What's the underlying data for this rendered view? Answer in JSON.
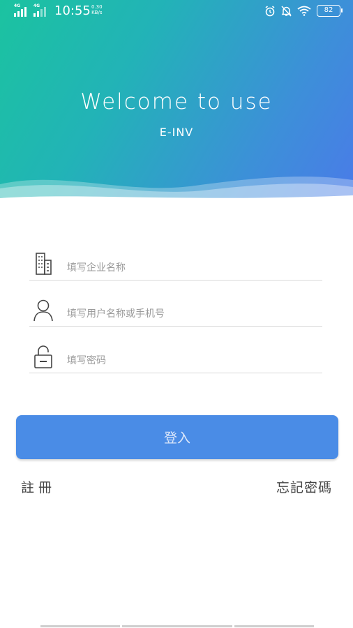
{
  "status_bar": {
    "signal_1": "4G",
    "signal_2": "4G",
    "time": "10:55",
    "speed_value": "0.30",
    "speed_unit": "KB/s",
    "battery": "82",
    "icons": [
      "alarm-icon",
      "mute-icon",
      "wifi-icon",
      "battery-icon"
    ]
  },
  "hero": {
    "welcome_text": "Welcome to use",
    "app_name": "E-INV",
    "gradient_colors": [
      "#1bc3a0",
      "#4a7be8"
    ]
  },
  "form": {
    "company_placeholder": "填写企业名称",
    "username_placeholder": "填写用户名称或手机号",
    "password_placeholder": "填写密码"
  },
  "actions": {
    "login_label": "登入",
    "register_label": "註冊",
    "forgot_label": "忘記密碼"
  },
  "colors": {
    "accent": "#4a8ce6"
  }
}
